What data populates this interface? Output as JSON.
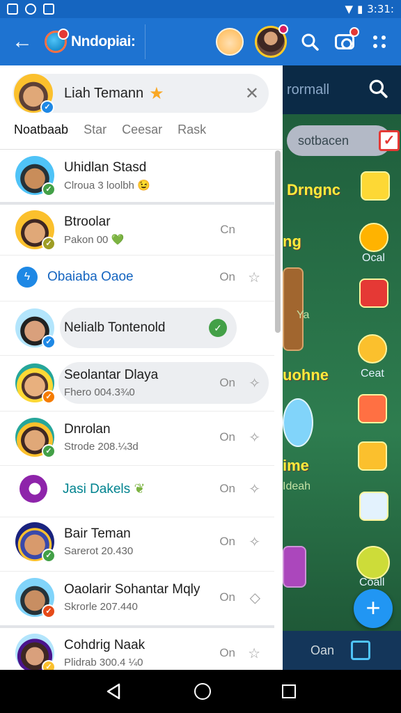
{
  "status_bar": {
    "time": "3:31:"
  },
  "app_bar": {
    "title": "Nndopiai:"
  },
  "profile": {
    "name": "Liah Temann"
  },
  "tabs": [
    "Noatbaab",
    "Star",
    "Ceesar",
    "Rask"
  ],
  "chats": [
    {
      "name": "Uhidlan Stasd",
      "sub": "Clroua 3 loolbh",
      "sub_emoji": "😉",
      "time": "",
      "check_color": "#43a047",
      "skin": "#c98d5a",
      "hat": "#263238"
    },
    {
      "name": "Btroolar",
      "sub": "Pakon 00",
      "sub_emoji": "💚",
      "time": "Cn",
      "check_color": "#9e9d24",
      "skin": "#e0a878",
      "hat": "#fbc02d"
    },
    {
      "name": "Obaiaba Oaoe",
      "sub": "",
      "time": "On",
      "check_color": "",
      "skin": "",
      "hat": ""
    },
    {
      "name": "Nelialb Tontenold",
      "sub": "",
      "time": "",
      "check_color": "#1e88e5",
      "skin": "#d9a07c",
      "hat": "#212121"
    },
    {
      "name": "Seolantar Dlaya",
      "sub": "Fhero 004.3¾0",
      "time": "On",
      "check_color": "#f57c00",
      "skin": "#e8b07e",
      "hat": "#fdd835"
    },
    {
      "name": "Dnrolan",
      "sub": "Strode 208.¼3d",
      "time": "On",
      "check_color": "#43a047",
      "skin": "#e0a878",
      "hat": "#fbc02d"
    },
    {
      "name": "Jasi Dakels",
      "sub": "",
      "time": "On",
      "check_color": "",
      "skin": "",
      "hat": ""
    },
    {
      "name": "Bair Teman",
      "sub": "Sarerot 20.430",
      "time": "On",
      "check_color": "#43a047",
      "skin": "#d89a6c",
      "hat": "#3949ab"
    },
    {
      "name": "Oaolarir Sohantar Mqly",
      "sub": "Skrorle 207.440",
      "time": "On",
      "check_color": "#e64a19",
      "skin": "#c88e62",
      "hat": "#263238"
    },
    {
      "name": "Cohdrig Naak",
      "sub": "Plidrab 300.4 ¼0",
      "time": "On",
      "check_color": "#fbc02d",
      "skin": "#d9a07c",
      "hat": "#4a148c"
    }
  ],
  "background": {
    "top_text": "rormall",
    "pill_text": "sotbacen",
    "label_1": "Drngnc",
    "label_2": "ng",
    "label_3": "Ya",
    "label_4": "uohne",
    "label_5": "ime",
    "label_6": "Ideah",
    "small_1": "Ocal",
    "small_2": "Ceat",
    "small_3": "Coall",
    "bottom_text": "Oan"
  }
}
